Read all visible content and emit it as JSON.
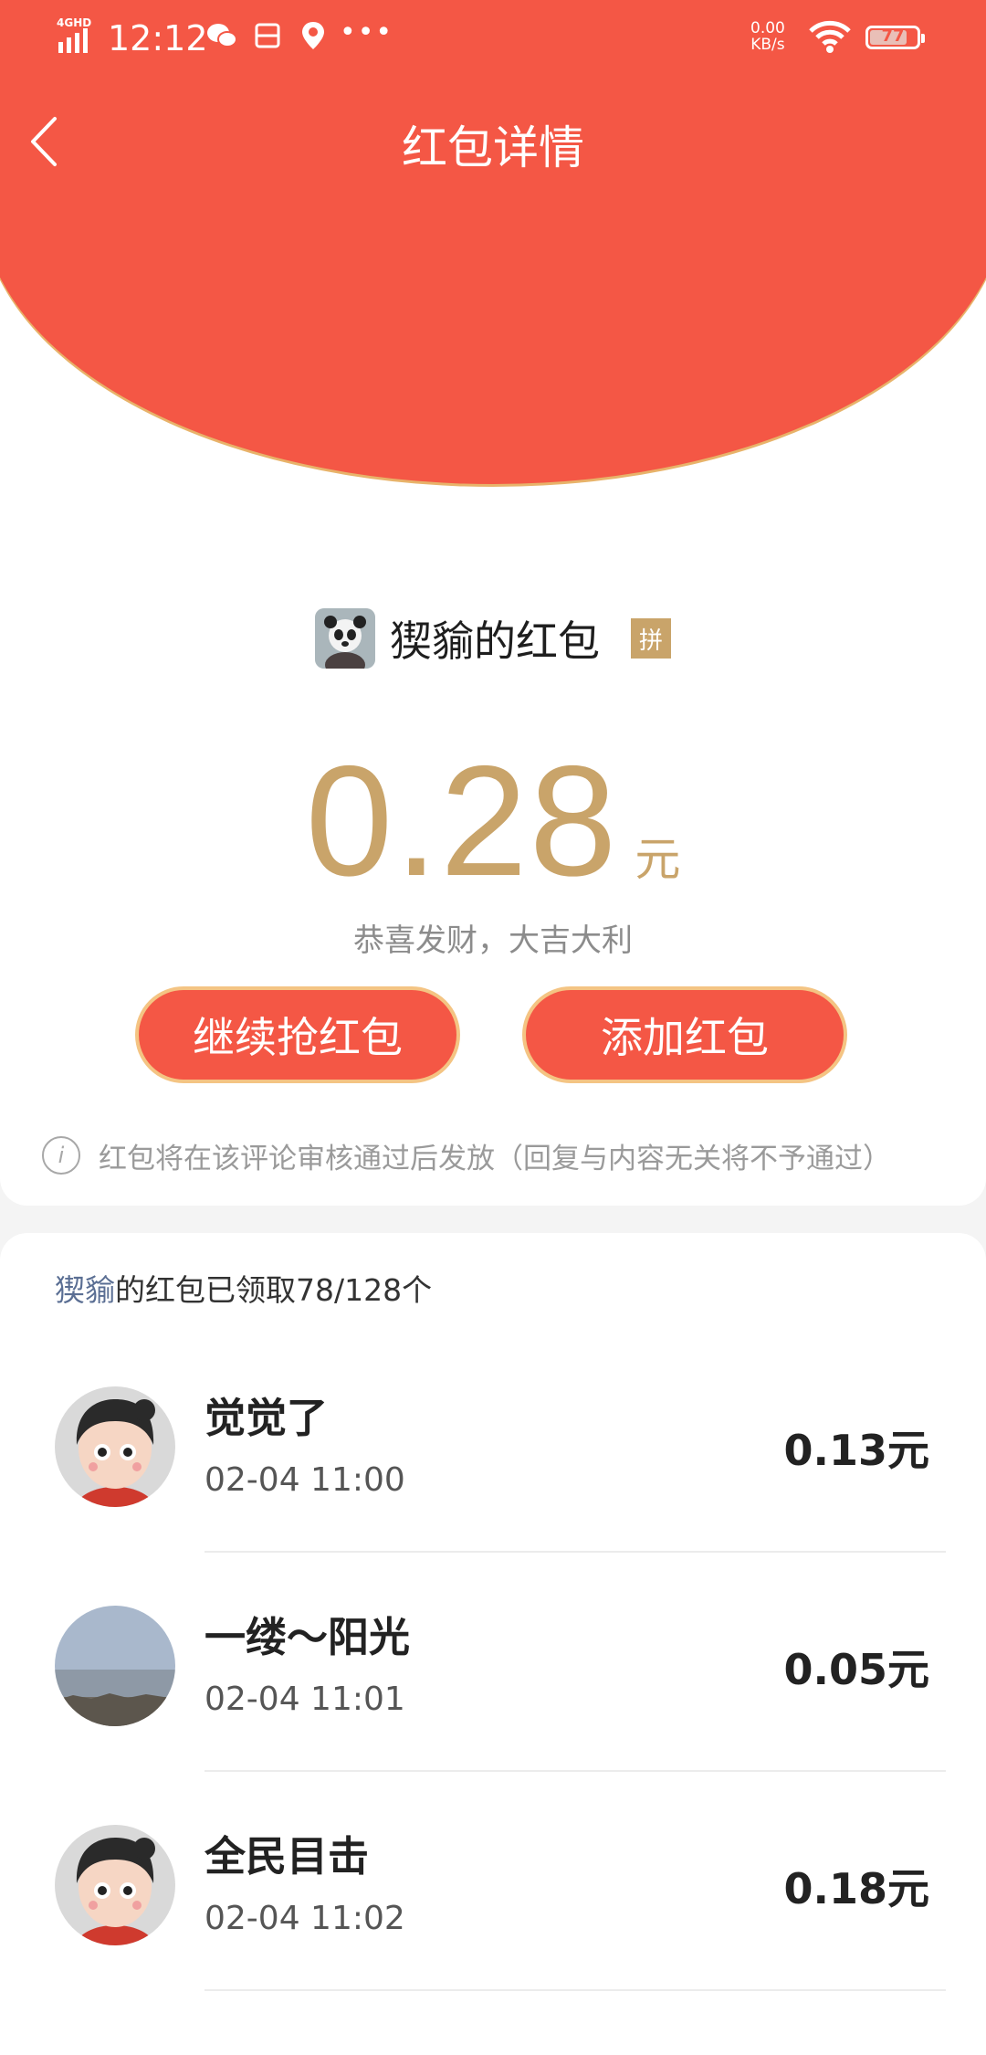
{
  "status_bar": {
    "network": "4GHD",
    "time": "12:12",
    "speed_value": "0.00",
    "speed_unit": "KB/s",
    "battery": "77",
    "icons": [
      "wechat-icon",
      "scan-icon",
      "location-icon",
      "more-dots-icon",
      "wifi-icon"
    ]
  },
  "header": {
    "title": "红包详情",
    "back_icon": "chevron-left-icon"
  },
  "sender": {
    "name": "猰貐的红包",
    "badge": "拼",
    "avatar_icon": "panda-avatar"
  },
  "amount": {
    "value": "0.28",
    "unit": "元"
  },
  "blessing": "恭喜发财，大吉大利",
  "buttons": {
    "grab_more": "继续抢红包",
    "add": "添加红包"
  },
  "notice": "红包将在该评论审核通过后发放（回复与内容无关将不予通过）",
  "summary": {
    "owner": "猰貐",
    "text": "的红包已领取78/128个"
  },
  "records": [
    {
      "name": "觉觉了",
      "time": "02-04 11:00",
      "amount": "0.13元",
      "avatar": "cartoon-girl-avatar"
    },
    {
      "name": "一缕～阳光",
      "time": "02-04 11:01",
      "amount": "0.05元",
      "avatar": "landscape-avatar"
    },
    {
      "name": "全民目击",
      "time": "02-04 11:02",
      "amount": "0.18元",
      "avatar": "cartoon-girl-avatar"
    }
  ],
  "colors": {
    "brand_red": "#f45745",
    "gold": "#c9a46a",
    "button_border": "#f4c483"
  }
}
